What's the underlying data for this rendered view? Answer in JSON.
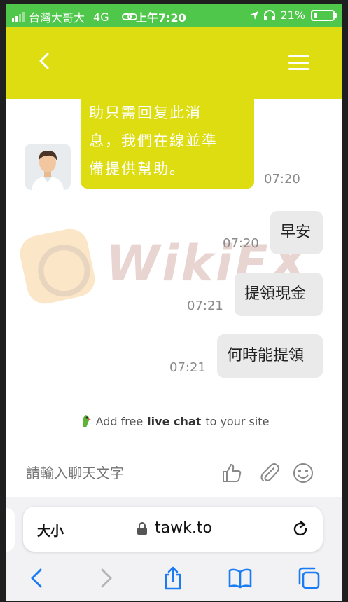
{
  "status_bar": {
    "carrier": "台灣大哥大",
    "network": "4G",
    "time": "上午7:20",
    "battery": "21%",
    "battery_level": 0.21
  },
  "colors": {
    "status_green": "#4fc74a",
    "accent": "#dddd11",
    "bubble_gray": "#eaeaea"
  },
  "chat": {
    "agent_message_lines": [
      "助只需回复此消",
      "息，我們在線並準",
      "備提供幫助。"
    ],
    "agent_time": "07:20",
    "user_messages": [
      {
        "text": "早安",
        "time": "07:20"
      },
      {
        "text": "提領現金",
        "time": "07:21"
      },
      {
        "text": "何時能提領",
        "time": "07:21"
      }
    ]
  },
  "watermark": {
    "text": "WikiFX"
  },
  "promo": {
    "prefix": "Add free",
    "bold": "live chat",
    "suffix": "to your site"
  },
  "input": {
    "placeholder": "請輸入聊天文字"
  },
  "browser": {
    "text_size_label": "大小",
    "url": "tawk.to"
  },
  "icons": [
    "back-icon",
    "menu-icon",
    "thumbs-up-icon",
    "paperclip-icon",
    "emoji-icon",
    "lock-icon",
    "reload-icon",
    "safari-back-icon",
    "safari-forward-icon",
    "share-icon",
    "bookmarks-icon",
    "tabs-icon"
  ]
}
